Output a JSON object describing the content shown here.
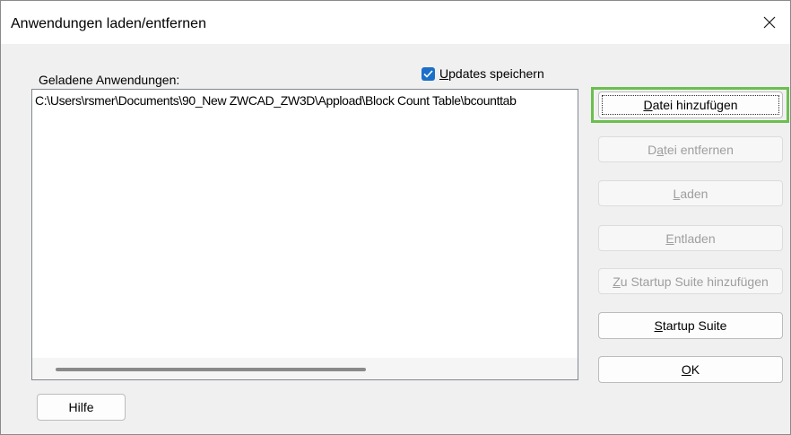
{
  "window": {
    "title": "Anwendungen laden/entfernen"
  },
  "icons": {
    "close": "close-icon",
    "checkmark": "checkmark-icon"
  },
  "colors": {
    "accent": "#1a6fc9",
    "highlight": "#6bbf4e"
  },
  "loaded": {
    "label": "Geladene Anwendungen:",
    "items": [
      "C:\\Users\\rsmer\\Documents\\90_New ZWCAD_ZW3D\\Appload\\Block Count Table\\bcounttab"
    ]
  },
  "updates": {
    "mnemonic": "U",
    "rest": "pdates speichern",
    "checked": true
  },
  "buttons": {
    "add": {
      "pre": "",
      "mn": "D",
      "post": "atei hinzufügen"
    },
    "remove": {
      "pre": "D",
      "mn": "a",
      "post": "tei entfernen"
    },
    "load": {
      "pre": "",
      "mn": "L",
      "post": "aden"
    },
    "unload": {
      "pre": "",
      "mn": "E",
      "post": "ntladen"
    },
    "startup_add": {
      "pre": "",
      "mn": "Z",
      "post": "u Startup Suite hinzufügen"
    },
    "startup": {
      "pre": "",
      "mn": "S",
      "post": "tartup Suite"
    },
    "ok": {
      "pre": "",
      "mn": "O",
      "post": "K"
    },
    "help": {
      "label": "Hilfe"
    }
  }
}
